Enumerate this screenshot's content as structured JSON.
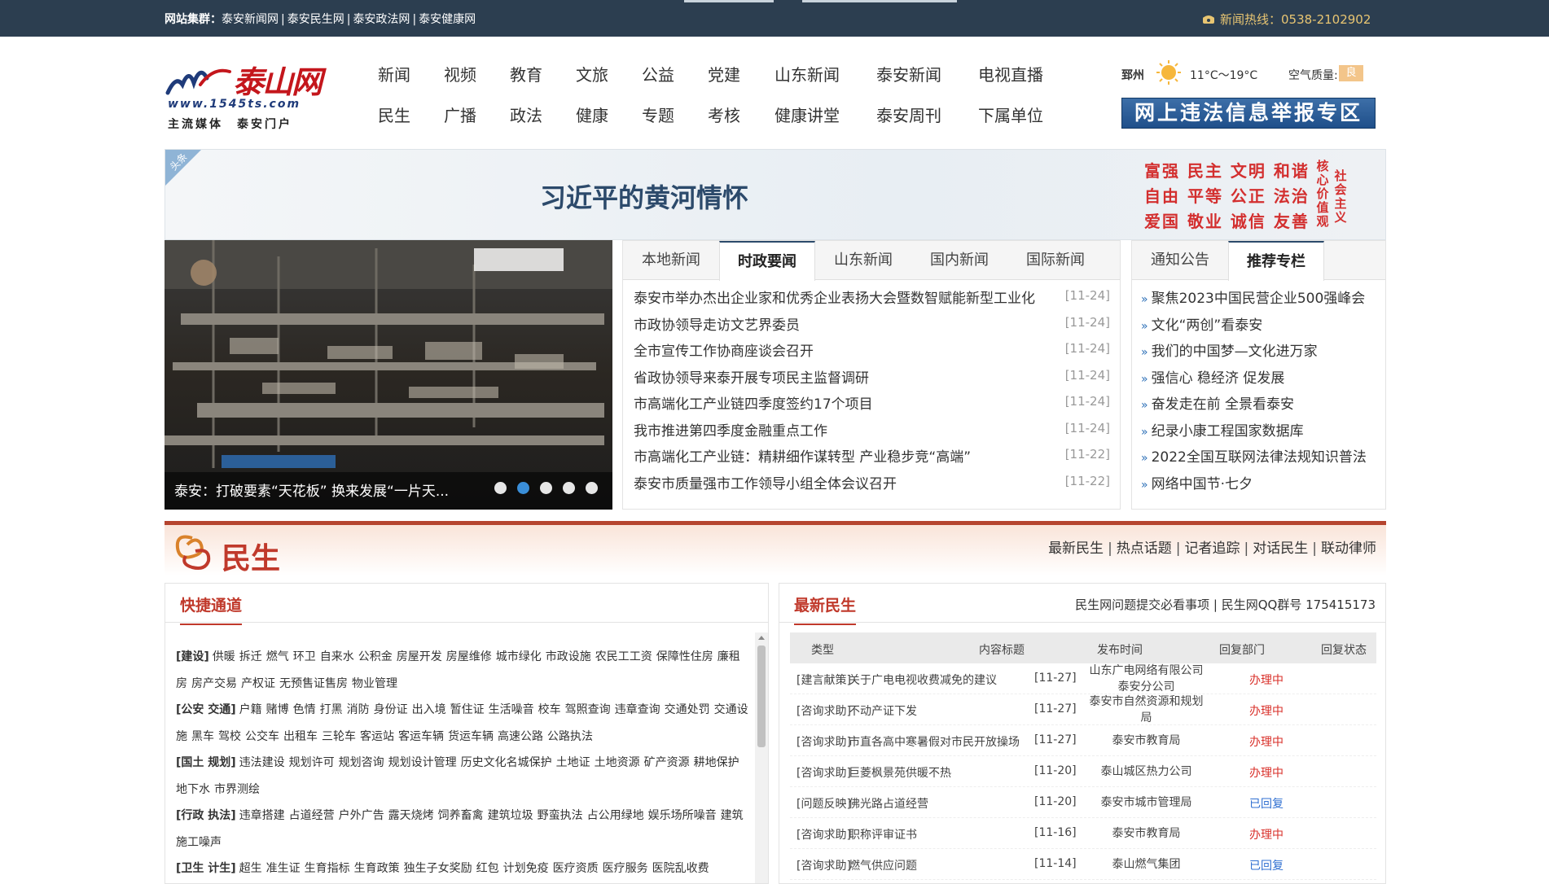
{
  "topbar": {
    "cluster_label": "网站集群：",
    "cluster_links": [
      "泰安新闻网",
      "泰安民生网",
      "泰安政法网",
      "泰安健康网"
    ],
    "hotline": "新闻热线：0538-2102902"
  },
  "logo": {
    "name": "泰山网",
    "url": "www.1545ts.com",
    "slogan": "主流媒体　泰安门户"
  },
  "nav": {
    "row1": [
      "新闻",
      "视频",
      "教育",
      "文旅",
      "公益",
      "党建",
      "山东新闻",
      "泰安新闻",
      "电视直播"
    ],
    "row2": [
      "民生",
      "广播",
      "政法",
      "健康",
      "专题",
      "考核",
      "健康讲堂",
      "泰安周刊",
      "下属单位"
    ]
  },
  "weather": {
    "city": "郅州",
    "temp": "11°C～19°C",
    "aq_label": "空气质量:",
    "aq_value": "良"
  },
  "report_banner": "网上违法信息举报专区",
  "headline": {
    "tag": "头条",
    "title": "习近平的黄河情怀"
  },
  "core_values": {
    "rows": [
      "富强 民主 文明 和谐",
      "自由 平等 公正 法治",
      "爱国 敬业 诚信 友善"
    ],
    "side1": "核心价值观",
    "side2": "社会主义"
  },
  "slider": {
    "caption": "泰安：打破要素“天花板” 换来发展“一片天...",
    "dot_count": 5,
    "active_dot": 1
  },
  "news_tabs": {
    "tabs": [
      "本地新闻",
      "时政要闻",
      "山东新闻",
      "国内新闻",
      "国际新闻"
    ],
    "active": 1,
    "items": [
      {
        "title": "泰安市举办杰出企业家和优秀企业表扬大会暨数智赋能新型工业化",
        "date": "[11-24]"
      },
      {
        "title": "市政协领导走访文艺界委员",
        "date": "[11-24]"
      },
      {
        "title": "全市宣传工作协商座谈会召开",
        "date": "[11-24]"
      },
      {
        "title": "省政协领导来泰开展专项民主监督调研",
        "date": "[11-24]"
      },
      {
        "title": "市高端化工产业链四季度签约17个项目",
        "date": "[11-24]"
      },
      {
        "title": "我市推进第四季度金融重点工作",
        "date": "[11-24]"
      },
      {
        "title": "市高端化工产业链：精耕细作谋转型 产业稳步竞“高端”",
        "date": "[11-22]"
      },
      {
        "title": "泰安市质量强市工作领导小组全体会议召开",
        "date": "[11-22]"
      }
    ]
  },
  "rec_tabs": {
    "tabs": [
      "通知公告",
      "推荐专栏"
    ],
    "active": 1,
    "items": [
      "聚焦2023中国民营企业500强峰会",
      "文化“两创”看泰安",
      "我们的中国梦—文化进万家",
      "强信心 稳经济 促发展",
      "奋发走在前 全景看泰安",
      "纪录小康工程国家数据库",
      "2022全国互联网法律法规知识普法",
      "网络中国节·七夕"
    ]
  },
  "minsheng": {
    "title": "民生",
    "links": [
      "最新民生",
      "热点话题",
      "记者追踪",
      "对话民生",
      "联动律师"
    ]
  },
  "quick_channel": {
    "title": "快捷通道",
    "groups": [
      {
        "cat": "[建设]",
        "links": [
          "供暖",
          "拆迁",
          "燃气",
          "环卫",
          "自来水",
          "公积金",
          "房屋开发",
          "房屋维修",
          "城市绿化",
          "市政设施",
          "农民工工资",
          "保障性住房",
          "廉租房",
          "房产交易",
          "产权证",
          "无预售证售房",
          "物业管理"
        ]
      },
      {
        "cat": "[公安 交通]",
        "links": [
          "户籍",
          "赌博",
          "色情",
          "打黑",
          "消防",
          "身份证",
          "出入境",
          "暂住证",
          "生活噪音",
          "校车",
          "驾照查询",
          "违章查询",
          "交通处罚",
          "交通设施",
          "黑车",
          "驾校",
          "公交车",
          "出租车",
          "三轮车",
          "客运站",
          "客运车辆",
          "货运车辆",
          "高速公路",
          "公路执法"
        ]
      },
      {
        "cat": "[国土 规划]",
        "links": [
          "违法建设",
          "规划许可",
          "规划咨询",
          "规划设计管理",
          "历史文化名城保护",
          "土地证",
          "土地资源",
          "矿产资源",
          "耕地保护",
          "地下水",
          "市界测绘"
        ]
      },
      {
        "cat": "[行政 执法]",
        "links": [
          "违章搭建",
          "占道经营",
          "户外广告",
          "露天烧烤",
          "饲养畜禽",
          "建筑垃圾",
          "野蛮执法",
          "占公用绿地",
          "娱乐场所噪音",
          "建筑施工噪声"
        ]
      },
      {
        "cat": "[卫生 计生]",
        "links": [
          "超生",
          "准生证",
          "生育指标",
          "生育政策",
          "独生子女奖励",
          "红包",
          "计划免疫",
          "医疗资质",
          "医疗服务",
          "医院乱收费"
        ]
      }
    ]
  },
  "latest": {
    "title": "最新民生",
    "right_links": [
      "民生网问题提交必看事项",
      "民生网QQ群号 175415173"
    ],
    "headers": [
      "类型",
      "内容标题",
      "发布时间",
      "回复部门",
      "回复状态"
    ],
    "rows": [
      {
        "type": "[建言献策]",
        "title": "关于广电电视收费减免的建议",
        "date": "[11-27]",
        "dept": "山东广电网络有限公司泰安分公司",
        "status": "办理中",
        "done": false
      },
      {
        "type": "[咨询求助]",
        "title": "不动产证下发",
        "date": "[11-27]",
        "dept": "泰安市自然资源和规划局",
        "status": "办理中",
        "done": false
      },
      {
        "type": "[咨询求助]",
        "title": "市直各高中寒暑假对市民开放操场",
        "date": "[11-27]",
        "dept": "泰安市教育局",
        "status": "办理中",
        "done": false
      },
      {
        "type": "[咨询求助]",
        "title": "巨菱枫景苑供暖不热",
        "date": "[11-20]",
        "dept": "泰山城区热力公司",
        "status": "办理中",
        "done": false
      },
      {
        "type": "[问题反映]",
        "title": "佛光路占道经营",
        "date": "[11-20]",
        "dept": "泰安市城市管理局",
        "status": "已回复",
        "done": true
      },
      {
        "type": "[咨询求助]",
        "title": "职称评审证书",
        "date": "[11-16]",
        "dept": "泰安市教育局",
        "status": "办理中",
        "done": false
      },
      {
        "type": "[咨询求助]",
        "title": "燃气供应问题",
        "date": "[11-14]",
        "dept": "泰山燃气集团",
        "status": "已回复",
        "done": true
      }
    ]
  },
  "colors": {
    "topbar": "#2c3e50",
    "accent_red": "#c0392b",
    "hotline": "#e8c572",
    "headline_text": "#2c4a6b"
  }
}
